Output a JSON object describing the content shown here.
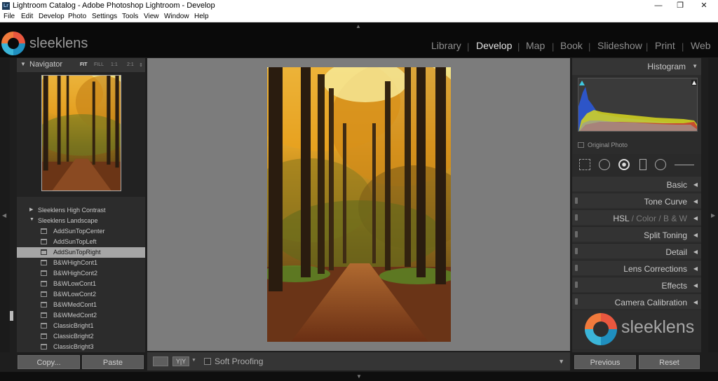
{
  "window": {
    "app_icon": "Lr",
    "title": "Lightroom Catalog - Adobe Photoshop Lightroom - Develop",
    "minimize": "—",
    "maximize": "❐",
    "close": "✕"
  },
  "menu": [
    "File",
    "Edit",
    "Develop",
    "Photo",
    "Settings",
    "Tools",
    "View",
    "Window",
    "Help"
  ],
  "identity_plate": {
    "text": "sleeklens"
  },
  "modules": [
    {
      "label": "Library",
      "active": false
    },
    {
      "label": "Develop",
      "active": true
    },
    {
      "label": "Map",
      "active": false
    },
    {
      "label": "Book",
      "active": false
    },
    {
      "label": "Slideshow",
      "active": false
    },
    {
      "label": "Print",
      "active": false
    },
    {
      "label": "Web",
      "active": false
    }
  ],
  "navigator": {
    "label": "Navigator",
    "zoom_options": [
      "FIT",
      "FILL",
      "1:1",
      "2:1"
    ],
    "zoom_active": "FIT",
    "zoom_arrows": "⇕"
  },
  "presets": {
    "folders": [
      {
        "label": "Sleeklens High Contrast",
        "expanded": false
      },
      {
        "label": "Sleeklens Landscape",
        "expanded": true
      }
    ],
    "items": [
      {
        "label": "AddSunTopCenter",
        "selected": false
      },
      {
        "label": "AddSunTopLeft",
        "selected": false
      },
      {
        "label": "AddSunTopRight",
        "selected": true
      },
      {
        "label": "B&WHighCont1",
        "selected": false
      },
      {
        "label": "B&WHighCont2",
        "selected": false
      },
      {
        "label": "B&WLowCont1",
        "selected": false
      },
      {
        "label": "B&WLowCont2",
        "selected": false
      },
      {
        "label": "B&WMedCont1",
        "selected": false
      },
      {
        "label": "B&WMedCont2",
        "selected": false
      },
      {
        "label": "ClassicBright1",
        "selected": false
      },
      {
        "label": "ClassicBright2",
        "selected": false
      },
      {
        "label": "ClassicBright3",
        "selected": false
      }
    ]
  },
  "left_buttons": {
    "copy": "Copy...",
    "paste": "Paste"
  },
  "toolbar": {
    "soft_proofing": "Soft Proofing",
    "soft_proofing_checked": false,
    "before_after_label": "Y|Y"
  },
  "right_panel": {
    "histogram_label": "Histogram",
    "original_photo": "Original Photo",
    "sections": [
      {
        "label": "Basic"
      },
      {
        "label": "Tone Curve"
      },
      {
        "label": "HSL",
        "extra": [
          "Color",
          "B & W"
        ]
      },
      {
        "label": "Split Toning"
      },
      {
        "label": "Detail"
      },
      {
        "label": "Lens Corrections"
      },
      {
        "label": "Effects"
      },
      {
        "label": "Camera Calibration"
      }
    ],
    "brand_text": "sleeklens"
  },
  "right_buttons": {
    "previous": "Previous",
    "reset": "Reset"
  },
  "icons": {
    "panel_collapse": "◀",
    "panel_expand": "▼",
    "folder_collapsed": "▶",
    "folder_expanded": "▼",
    "dropdown": "▼"
  },
  "colors": {
    "active_module": "#e6e6e6",
    "inactive_module": "#8f8f8f",
    "selected_preset_bg": "#a6a6a6",
    "canvas_bg": "#7c7c7c"
  }
}
